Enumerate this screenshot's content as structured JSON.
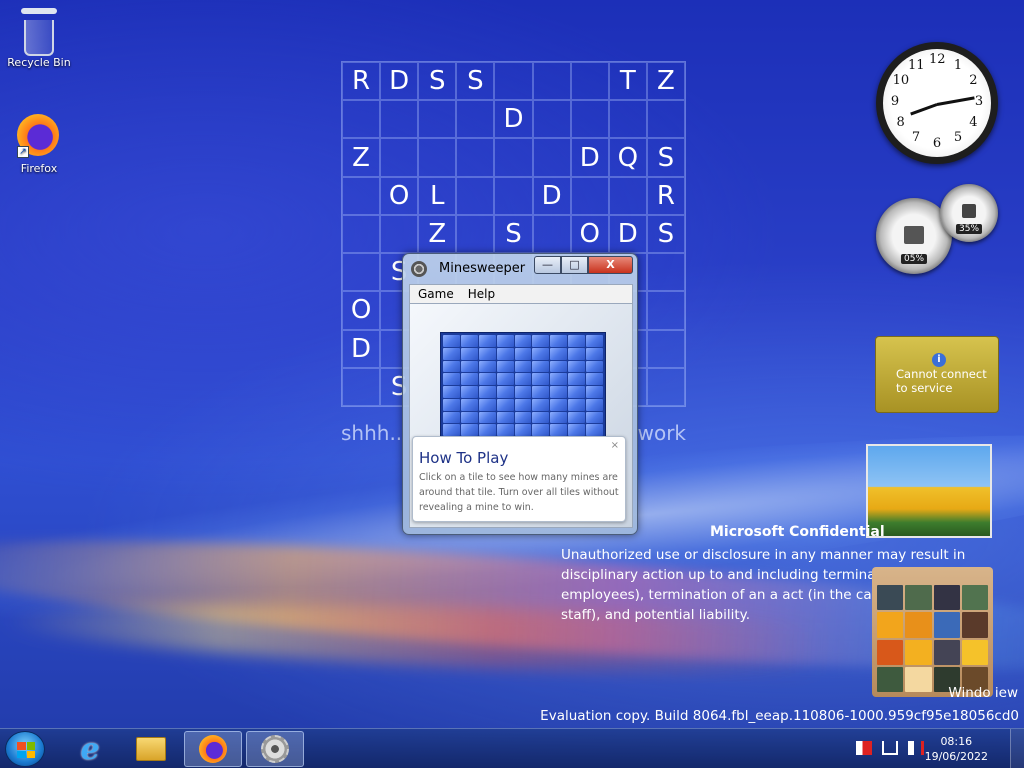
{
  "desktop": {
    "icons": [
      {
        "label": "Recycle Bin"
      },
      {
        "label": "Firefox"
      }
    ]
  },
  "letter_grid": {
    "rows": [
      [
        "R",
        "D",
        "S",
        "S",
        "",
        "",
        "",
        "T",
        "Z"
      ],
      [
        "",
        "",
        "",
        "",
        "D",
        "",
        "",
        "",
        ""
      ],
      [
        "Z",
        "",
        "",
        "",
        "",
        "",
        "D",
        "Q",
        "S"
      ],
      [
        "",
        "O",
        "L",
        "",
        "",
        "D",
        "",
        "",
        "R"
      ],
      [
        "",
        "",
        "Z",
        "",
        "S",
        "",
        "O",
        "D",
        "S"
      ],
      [
        "",
        "S",
        "",
        "",
        "",
        "",
        "",
        "",
        ""
      ],
      [
        "O",
        "",
        "",
        "",
        "",
        "",
        "",
        "",
        ""
      ],
      [
        "D",
        "",
        "",
        "",
        "",
        "",
        "",
        "",
        ""
      ],
      [
        "",
        "S",
        "",
        "",
        "",
        "",
        "",
        "",
        ""
      ]
    ],
    "caption_left": "shhh..",
    "caption_right": "work"
  },
  "gadgets": {
    "clock_numbers": [
      "12",
      "1",
      "2",
      "3",
      "4",
      "5",
      "6",
      "7",
      "8",
      "9",
      "10",
      "11"
    ],
    "cpu_meter_value": "05%",
    "memory_meter_value": "35%",
    "weather_message": "Cannot connect to service",
    "weather_info_icon": "i"
  },
  "watermark": {
    "title": "Microsoft Confidential",
    "body": "Unauthorized use or disclosure in any manner may result in disciplinary action up to and including termina t (in the case of employees), termination of an a act (in the case of contingent staff), and potential liability.",
    "build_line1": "Windo iew",
    "build_line2": "Evaluation copy. Build 8064.fbl_eeap.110806-1000.959cf95e18056cd0"
  },
  "minesweeper": {
    "title": "Minesweeper",
    "min_glyph": "—",
    "max_glyph": "□",
    "close_glyph": "X",
    "menu": [
      "Game",
      "Help"
    ],
    "board_cols": 9,
    "board_rows": 9,
    "tip": {
      "title": "How To Play",
      "body": "Click on a tile to see how many mines are around that tile. Turn over all tiles without revealing a mine to win.",
      "close_glyph": "×"
    }
  },
  "taskbar": {
    "time": "08:16",
    "date": "19/06/2022",
    "tray_icons": [
      "action-center-flag-icon",
      "network-icon",
      "volume-muted-icon"
    ]
  }
}
